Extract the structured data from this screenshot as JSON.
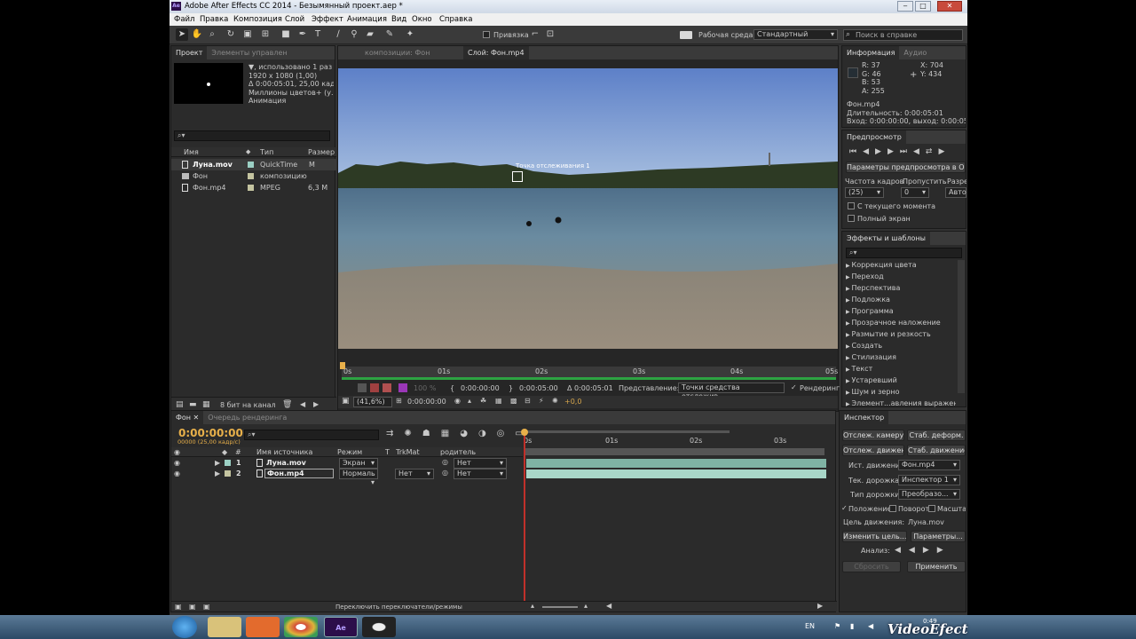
{
  "title_bar": {
    "title": "Adobe After Effects CC 2014 - Безымянный проект.aep *",
    "minimize": "‒",
    "maximize": "□",
    "close": "✕"
  },
  "menu": [
    "Файл",
    "Правка",
    "Композиция",
    "Слой",
    "Эффект",
    "Анимация",
    "Вид",
    "Окно",
    "Справка"
  ],
  "toolbar": {
    "snap_label": "Привязка",
    "workspace_label": "Рабочая среда:",
    "workspace_value": "Стандартный",
    "search_placeholder": "Поиск в справке"
  },
  "project": {
    "tab": "Проект",
    "tab2": "Элементы управлен",
    "info_lines": [
      "▼, использовано 1 раз",
      "1920 x 1080 (1,00)",
      "Δ 0:00:05:01, 25,00 кад...",
      "Миллионы цветов+ (у...",
      "Анимация"
    ],
    "search_placeholder": "",
    "col_name": "Имя",
    "col_type": "Тип",
    "col_size": "Размер",
    "items": [
      {
        "name": "Луна.mov",
        "type": "QuickTime",
        "size": "М"
      },
      {
        "name": "Фон",
        "type": "композицию",
        "size": ""
      },
      {
        "name": "Фон.mp4",
        "type": "MPEG",
        "size": "6,3 М"
      }
    ],
    "bit_depth": "8 бит на канал"
  },
  "viewer": {
    "tab_comp": "композиции: Фон",
    "tab_layer": "Слой: Фон.mp4",
    "track_point_label": "Точка отслеживания 1",
    "ruler": [
      "0s",
      "01s",
      "02s",
      "03s",
      "04s",
      "05s"
    ],
    "time_current": "0:00:00:00",
    "time_out": "0:00:05:00",
    "time_duration": "Δ 0:00:05:01",
    "view_label": "Представление:",
    "view_value": "Точки средства отслежив...",
    "render_label": "Рендеринг",
    "zoom": "(41,6%)",
    "timecode": "0:00:00:00",
    "exposure": "+0,0",
    "opacity": "100 %"
  },
  "info": {
    "tab": "Информация",
    "tab2": "Аудио",
    "r": "R:  37",
    "g": "G:  46",
    "b": "B:  53",
    "a": "A:  255",
    "x": "X:  704",
    "y": "Y:  434",
    "file": "Фон.mp4",
    "duration": "Длительность: 0:00:05:01",
    "inout": "Вход: 0:00:00:00, выход: 0:00:05:00"
  },
  "preview": {
    "tab": "Предпросмотр",
    "ram_button": "Параметры предпросмотра в ОЗУ",
    "fps_label": "Частота кадров",
    "skip_label": "Пропустить",
    "res_label": "Разрешение",
    "fps_value": "(25)",
    "skip_value": "0",
    "res_value": "Авто",
    "from_current": "С текущего момента",
    "full_screen": "Полный экран"
  },
  "effects": {
    "tab": "Эффекты и шаблоны",
    "items": [
      "Коррекция цвета",
      "Переход",
      "Перспектива",
      "Подложка",
      "Программа",
      "Прозрачное наложение",
      "Размытие и резкость",
      "Создать",
      "Стилизация",
      "Текст",
      "Устаревший",
      "Шум и зерно",
      "Элемент...авления выражения"
    ]
  },
  "timeline": {
    "tab_comp": "Фон",
    "tab_render": "Очередь рендеринга",
    "time": "0:00:00:00",
    "fps_line": "00000 (25,00 кадр/с)",
    "col_num": "#",
    "col_source": "Имя источника",
    "col_mode": "Режим",
    "col_t": "T",
    "col_trkmat": "TrkMat",
    "col_parent": "родитель",
    "ruler": [
      "0s",
      "01s",
      "02s",
      "03s"
    ],
    "layers": [
      {
        "num": "1",
        "name": "Луна.mov",
        "mode": "Экран",
        "trkmat": "",
        "parent": "Нет"
      },
      {
        "num": "2",
        "name": "Фон.mp4",
        "mode": "Нормаль",
        "trkmat": "Нет",
        "parent": "Нет"
      }
    ],
    "footer": "Переключить переключатели/режимы"
  },
  "tracker": {
    "tab": "Инспектор",
    "track_camera": "Отслеж. камеру",
    "stab_warp": "Стаб. деформ.",
    "track_motion": "Отслеж. движение",
    "stab_motion": "Стаб. движение",
    "source_label": "Ист. движения:",
    "source_value": "Фон.mp4",
    "current_label": "Тек. дорожка:",
    "current_value": "Инспектор 1",
    "type_label": "Тип дорожки:",
    "type_value": "Преобразо...",
    "pos": "Положение",
    "rot": "Поворот",
    "scale": "Масштаб",
    "target_label": "Цель движения:",
    "target_value": "Луна.mov",
    "edit_target": "Изменить цель...",
    "options": "Параметры...",
    "analyze": "Анализ:",
    "reset": "Сбросить",
    "apply": "Применить"
  },
  "taskbar": {
    "lang": "EN",
    "clock": "0:49",
    "watermark": "VideoEfect"
  },
  "colors": {
    "bg": "#323232",
    "accent": "#e8b04a",
    "track_bar": "#7fb3a4"
  }
}
